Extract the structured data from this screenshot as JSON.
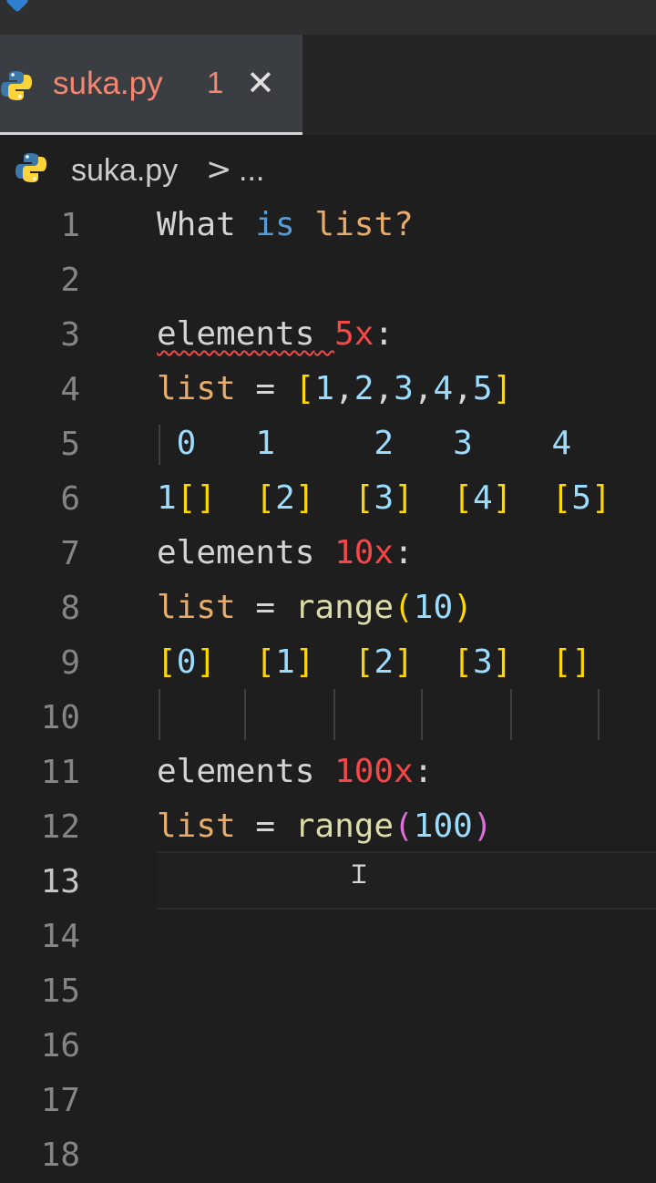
{
  "tab": {
    "file_name": "suka.py",
    "problem_count": "1",
    "close_glyph": "✕"
  },
  "breadcrumb": {
    "file_name": "suka.py",
    "separator": ">",
    "more": "..."
  },
  "editor": {
    "active_line": 13,
    "line_numbers": [
      "1",
      "2",
      "3",
      "4",
      "5",
      "6",
      "7",
      "8",
      "9",
      "10",
      "11",
      "12",
      "13",
      "14",
      "15",
      "16",
      "17",
      "18"
    ],
    "lines": [
      {
        "segments": [
          {
            "t": "What ",
            "c": "plain"
          },
          {
            "t": "is",
            "c": "kw"
          },
          {
            "t": " ",
            "c": "plain"
          },
          {
            "t": "list",
            "c": "orange"
          },
          {
            "t": "?",
            "c": "orange"
          }
        ]
      },
      {
        "segments": []
      },
      {
        "segments": [
          {
            "t": "elements",
            "c": "plain",
            "sq": true
          },
          {
            "t": " ",
            "c": "plain",
            "sq": true
          },
          {
            "t": "5x",
            "c": "red"
          },
          {
            "t": ":",
            "c": "plain"
          }
        ]
      },
      {
        "segments": [
          {
            "t": "list",
            "c": "orange"
          },
          {
            "t": " = ",
            "c": "plain"
          },
          {
            "t": "[",
            "c": "br1"
          },
          {
            "t": "1",
            "c": "blue"
          },
          {
            "t": ",",
            "c": "plain"
          },
          {
            "t": "2",
            "c": "blue"
          },
          {
            "t": ",",
            "c": "plain"
          },
          {
            "t": "3",
            "c": "blue"
          },
          {
            "t": ",",
            "c": "plain"
          },
          {
            "t": "4",
            "c": "blue"
          },
          {
            "t": ",",
            "c": "plain"
          },
          {
            "t": "5",
            "c": "blue"
          },
          {
            "t": "]",
            "c": "br1"
          }
        ]
      },
      {
        "segments": [
          {
            "t": " 0   1     2   3    4",
            "c": "blue"
          }
        ]
      },
      {
        "segments": [
          {
            "t": "1",
            "c": "blue"
          },
          {
            "t": "[]",
            "c": "br1"
          },
          {
            "t": "  ",
            "c": "plain"
          },
          {
            "t": "[",
            "c": "br1"
          },
          {
            "t": "2",
            "c": "blue"
          },
          {
            "t": "]",
            "c": "br1"
          },
          {
            "t": "  ",
            "c": "plain"
          },
          {
            "t": "[",
            "c": "br1"
          },
          {
            "t": "3",
            "c": "blue"
          },
          {
            "t": "]",
            "c": "br1"
          },
          {
            "t": "  ",
            "c": "plain"
          },
          {
            "t": "[",
            "c": "br1"
          },
          {
            "t": "4",
            "c": "blue"
          },
          {
            "t": "]",
            "c": "br1"
          },
          {
            "t": "  ",
            "c": "plain"
          },
          {
            "t": "[",
            "c": "br1"
          },
          {
            "t": "5",
            "c": "blue"
          },
          {
            "t": "]",
            "c": "br1"
          }
        ]
      },
      {
        "segments": [
          {
            "t": "elements ",
            "c": "plain"
          },
          {
            "t": "10x",
            "c": "red"
          },
          {
            "t": ":",
            "c": "plain"
          }
        ]
      },
      {
        "segments": [
          {
            "t": "list",
            "c": "orange"
          },
          {
            "t": " = ",
            "c": "plain"
          },
          {
            "t": "range",
            "c": "fn"
          },
          {
            "t": "(",
            "c": "br1"
          },
          {
            "t": "10",
            "c": "blue"
          },
          {
            "t": ")",
            "c": "br1"
          }
        ]
      },
      {
        "segments": [
          {
            "t": "[",
            "c": "br1"
          },
          {
            "t": "0",
            "c": "blue"
          },
          {
            "t": "]",
            "c": "br1"
          },
          {
            "t": "  ",
            "c": "plain"
          },
          {
            "t": "[",
            "c": "br1"
          },
          {
            "t": "1",
            "c": "blue"
          },
          {
            "t": "]",
            "c": "br1"
          },
          {
            "t": "  ",
            "c": "plain"
          },
          {
            "t": "[",
            "c": "br1"
          },
          {
            "t": "2",
            "c": "blue"
          },
          {
            "t": "]",
            "c": "br1"
          },
          {
            "t": "  ",
            "c": "plain"
          },
          {
            "t": "[",
            "c": "br1"
          },
          {
            "t": "3",
            "c": "blue"
          },
          {
            "t": "]",
            "c": "br1"
          },
          {
            "t": "  ",
            "c": "plain"
          },
          {
            "t": "[]",
            "c": "br1"
          }
        ]
      },
      {
        "segments": []
      },
      {
        "segments": [
          {
            "t": "elements ",
            "c": "plain"
          },
          {
            "t": "100x",
            "c": "red"
          },
          {
            "t": ":",
            "c": "plain"
          }
        ]
      },
      {
        "segments": [
          {
            "t": "list",
            "c": "orange"
          },
          {
            "t": " = ",
            "c": "plain"
          },
          {
            "t": "range",
            "c": "fn"
          },
          {
            "t": "(",
            "c": "br2"
          },
          {
            "t": "100",
            "c": "blue"
          },
          {
            "t": ")",
            "c": "br2"
          }
        ]
      },
      {
        "segments": []
      },
      {
        "segments": []
      },
      {
        "segments": []
      },
      {
        "segments": []
      },
      {
        "segments": []
      },
      {
        "segments": []
      }
    ]
  },
  "colors": {
    "background": "#1e1e1e",
    "tab_active_bg": "#3a3d41",
    "error_text": "#f48771",
    "keyword": "#569cd6",
    "identifier": "#e8ab6a",
    "bracket_level1": "#ffd700",
    "bracket_level2": "#da70d6",
    "number": "#9cdcfe",
    "error_squiggle": "#f14c4c"
  }
}
